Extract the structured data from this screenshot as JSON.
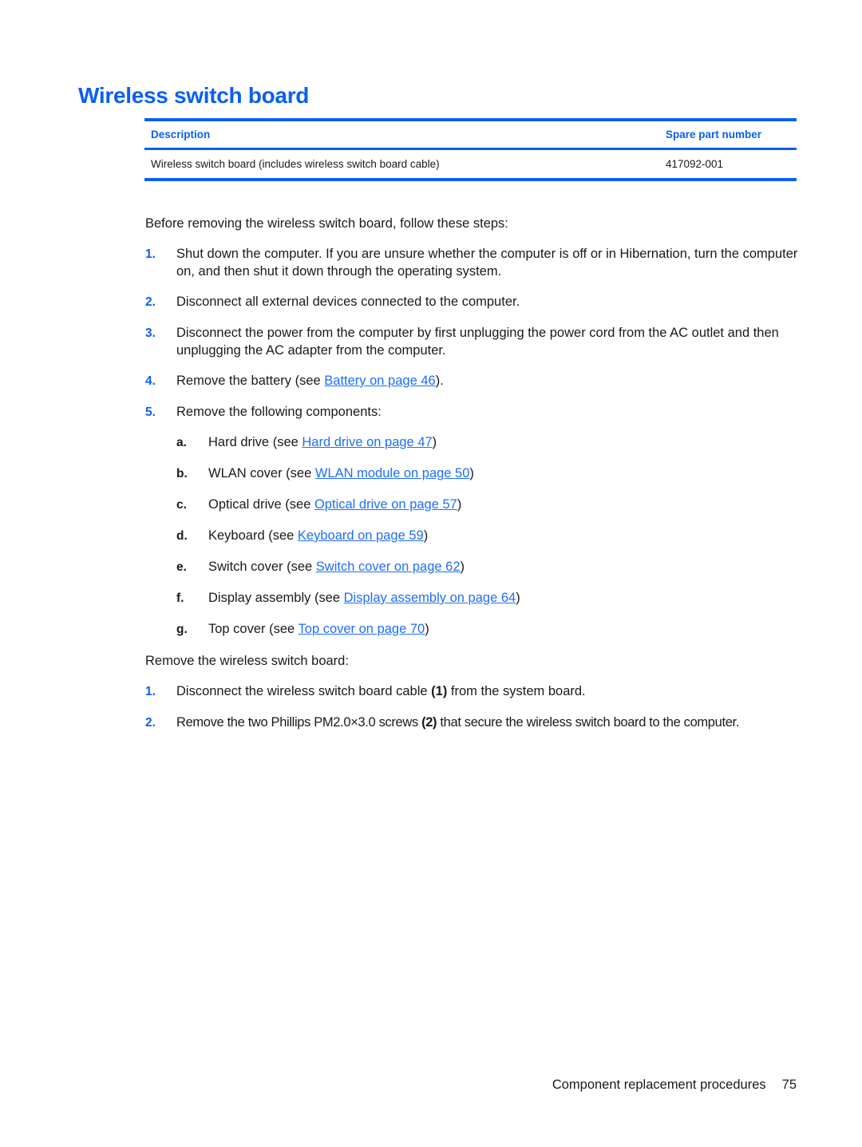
{
  "page": {
    "title": "Wireless switch board",
    "table": {
      "headers": [
        "Description",
        "Spare part number"
      ],
      "rows": [
        {
          "description": "Wireless switch board (includes wireless switch board cable)",
          "part_number": "417092-001"
        }
      ]
    },
    "intro": "Before removing the wireless switch board, follow these steps:",
    "prep_steps": [
      {
        "num": "1.",
        "text": "Shut down the computer. If you are unsure whether the computer is off or in Hibernation, turn the computer on, and then shut it down through the operating system."
      },
      {
        "num": "2.",
        "text": "Disconnect all external devices connected to the computer."
      },
      {
        "num": "3.",
        "text": "Disconnect the power from the computer by first unplugging the power cord from the AC outlet and then unplugging the AC adapter from the computer."
      },
      {
        "num": "4.",
        "pre": "Remove the battery (see ",
        "link": "Battery on page 46",
        "post": ")."
      },
      {
        "num": "5.",
        "text": "Remove the following components:"
      }
    ],
    "components": [
      {
        "letter": "a.",
        "pre": "Hard drive (see ",
        "link": "Hard drive on page 47",
        "post": ")"
      },
      {
        "letter": "b.",
        "pre": "WLAN cover (see ",
        "link": "WLAN module on page 50",
        "post": ")"
      },
      {
        "letter": "c.",
        "pre": "Optical drive (see ",
        "link": "Optical drive on page 57",
        "post": ")"
      },
      {
        "letter": "d.",
        "pre": "Keyboard (see ",
        "link": "Keyboard on page 59",
        "post": ")"
      },
      {
        "letter": "e.",
        "pre": "Switch cover (see ",
        "link": "Switch cover on page 62",
        "post": ")"
      },
      {
        "letter": "f.",
        "pre": "Display assembly (see ",
        "link": "Display assembly on page 64",
        "post": ")"
      },
      {
        "letter": "g.",
        "pre": "Top cover (see ",
        "link": "Top cover on page 70",
        "post": ")"
      }
    ],
    "removal_intro": "Remove the wireless switch board:",
    "removal_steps": [
      {
        "num": "1.",
        "pre": "Disconnect the wireless switch board cable ",
        "callout": "(1)",
        "post": " from the system board."
      },
      {
        "num": "2.",
        "pre": "Remove the two Phillips PM2.0×3.0 screws ",
        "callout": "(2)",
        "post": " that secure the wireless switch board to the computer."
      }
    ],
    "footer": {
      "section": "Component replacement procedures",
      "page_number": "75"
    },
    "colors": {
      "accent": "#0a5ff0",
      "link": "#1e6ef5",
      "text": "#1a1a1a"
    }
  }
}
